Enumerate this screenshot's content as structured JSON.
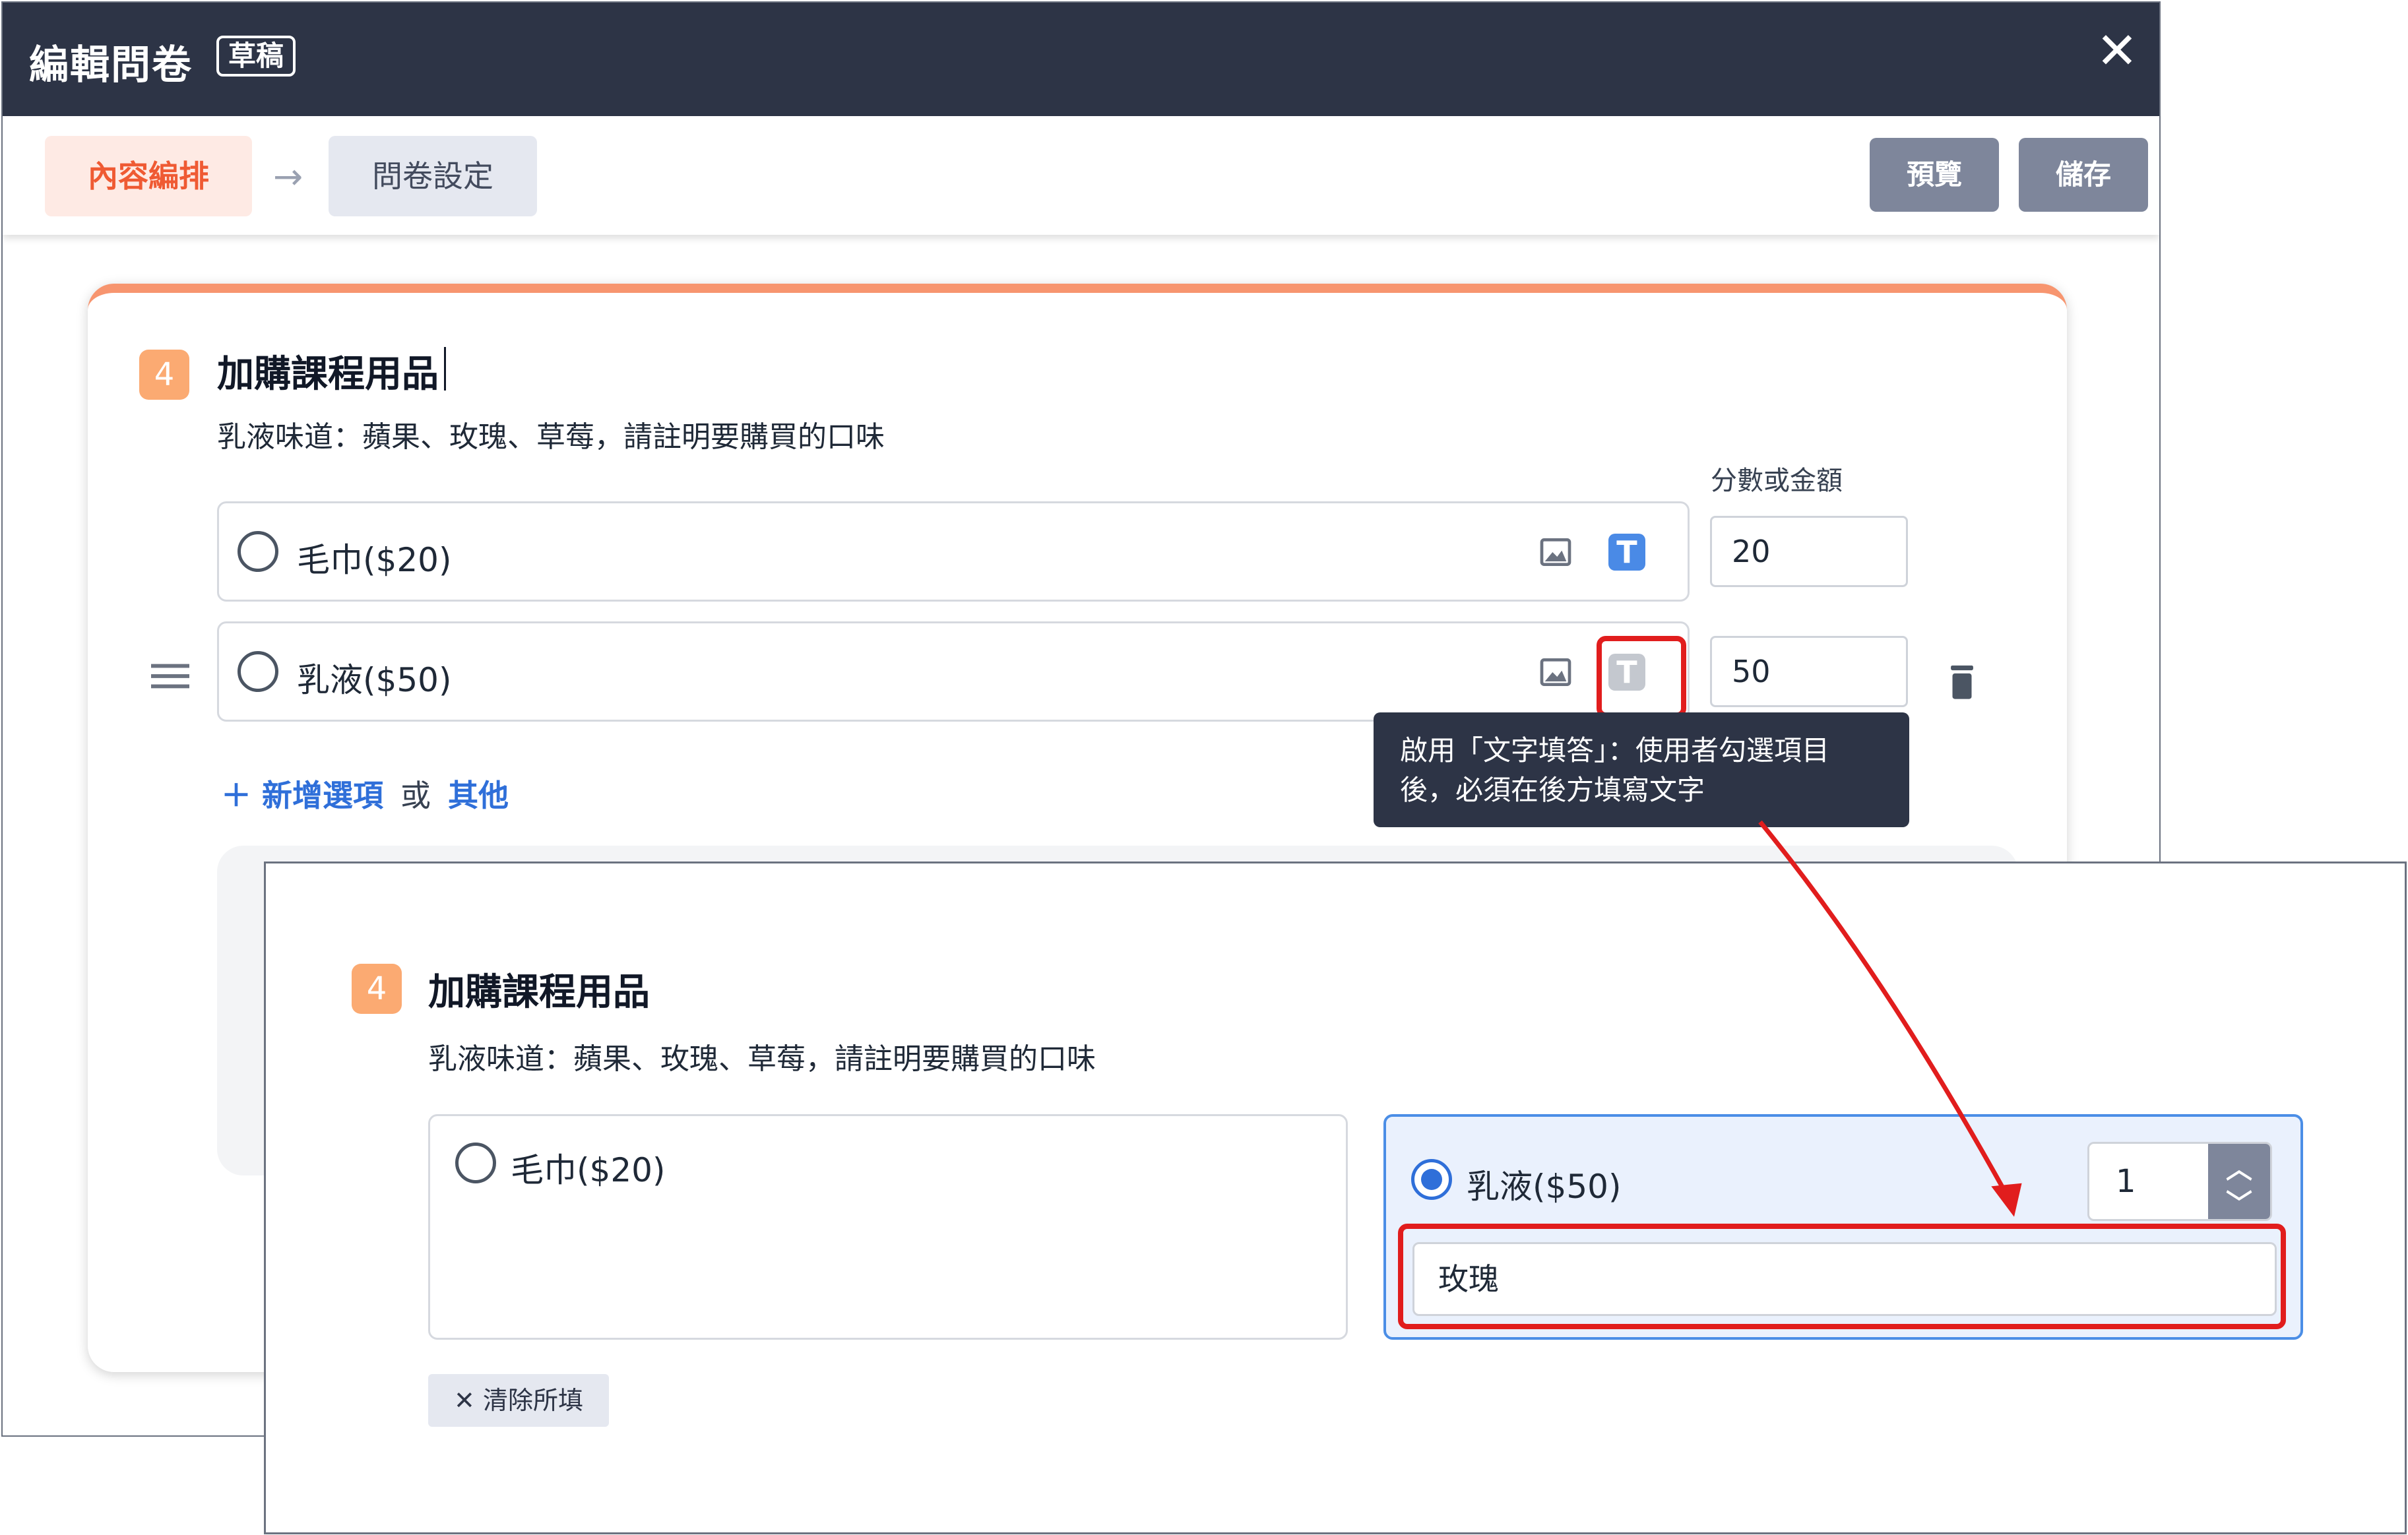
{
  "editor": {
    "title": "編輯問卷",
    "status_badge": "草稿",
    "close_glyph": "✕",
    "steps": [
      {
        "label": "內容編排",
        "active": true
      },
      {
        "label": "問卷設定",
        "active": false
      }
    ],
    "step_arrow": "→",
    "preview_label": "預覽",
    "save_label": "儲存",
    "question": {
      "number": "4",
      "title": "加購課程用品",
      "description": "乳液味道：蘋果、玫瑰、草莓，請註明要購買的口味",
      "score_header": "分數或金額",
      "options": [
        {
          "label": "毛巾($20)",
          "score": "20",
          "text_answer_enabled": true
        },
        {
          "label": "乳液($50)",
          "score": "50",
          "text_answer_enabled": false
        }
      ],
      "add_option_label": "＋ 新增選項",
      "or_label": "或",
      "other_label": "其他"
    },
    "tooltip": "啟用「文字填答」：使用者勾選項目後，必須在後方填寫文字"
  },
  "preview": {
    "question": {
      "number": "4",
      "title": "加購課程用品",
      "description": "乳液味道：蘋果、玫瑰、草莓，請註明要購買的口味"
    },
    "options": [
      {
        "label": "毛巾($20)",
        "selected": false
      },
      {
        "label": "乳液($50)",
        "selected": true,
        "quantity": "1",
        "text_answer": "玫瑰"
      }
    ],
    "clear_label": "清除所填",
    "clear_glyph": "✕"
  },
  "colors": {
    "header_bg": "#2d3446",
    "accent_orange": "#ef5a33",
    "badge_orange": "#fbaa72",
    "link_blue": "#2f6fd9",
    "highlight_red": "#e11d1d",
    "selected_bg": "#eaf1fd"
  },
  "icons": [
    "close-icon",
    "arrow-right-icon",
    "image-icon",
    "text-answer-icon",
    "drag-handle-icon",
    "trash-icon",
    "chevron-up-icon",
    "chevron-down-icon"
  ]
}
